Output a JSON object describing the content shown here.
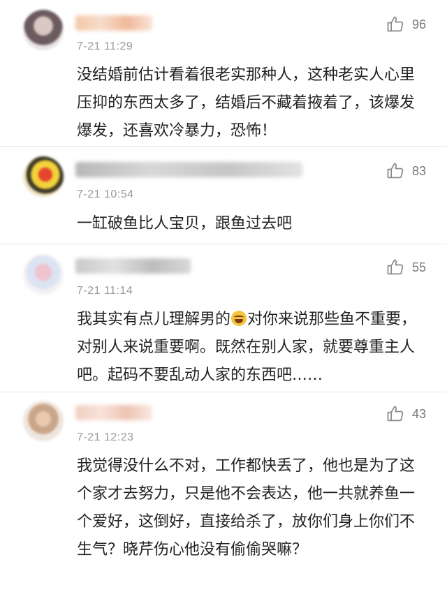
{
  "comments": [
    {
      "username": "",
      "timestamp": "7-21 11:29",
      "likes": "96",
      "text": "没结婚前估计看着很老实那种人，这种老实人心里压抑的东西太多了，结婚后不藏着掖着了，该爆发爆发，还喜欢冷暴力，恐怖！"
    },
    {
      "username": "",
      "timestamp": "7-21 10:54",
      "likes": "83",
      "text": "一缸破鱼比人宝贝，跟鱼过去吧"
    },
    {
      "username": "",
      "timestamp": "7-21 11:14",
      "likes": "55",
      "text_before_emoji": "我其实有点儿理解男的",
      "emoji": "laugh-cry-emoji",
      "text_after_emoji": "对你来说那些鱼不重要，对别人来说重要啊。既然在别人家，就要尊重主人吧。起码不要乱动人家的东西吧……"
    },
    {
      "username": "",
      "timestamp": "7-21 12:23",
      "likes": "43",
      "text": "我觉得没什么不对，工作都快丢了，他也是为了这个家才去努力，只是他不会表达，他一共就养鱼一个爱好，这倒好，直接给杀了，放你们身上你们不生气？晓芹伤心他没有偷偷哭嘛？"
    }
  ],
  "icons": {
    "like": "thumbs-up-icon"
  },
  "colors": {
    "text": "#222222",
    "meta": "#9a9a9a",
    "divider": "#e6e6e6"
  }
}
